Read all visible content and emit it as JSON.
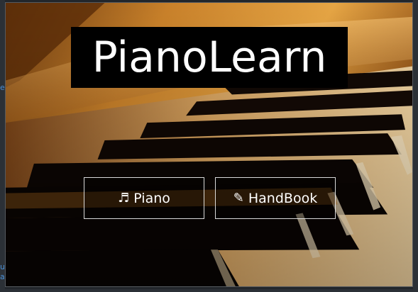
{
  "edge": {
    "left_fragments": [
      "e",
      "u",
      "a"
    ]
  },
  "hero": {
    "title": "PianoLearn"
  },
  "nav": {
    "piano": {
      "icon": "♬",
      "label": "Piano"
    },
    "handbook": {
      "icon": "✎",
      "label": "HandBook"
    }
  },
  "colors": {
    "title_bg": "#000000",
    "title_fg": "#ffffff",
    "button_border": "#ffffff",
    "wood": "#b8741c"
  }
}
